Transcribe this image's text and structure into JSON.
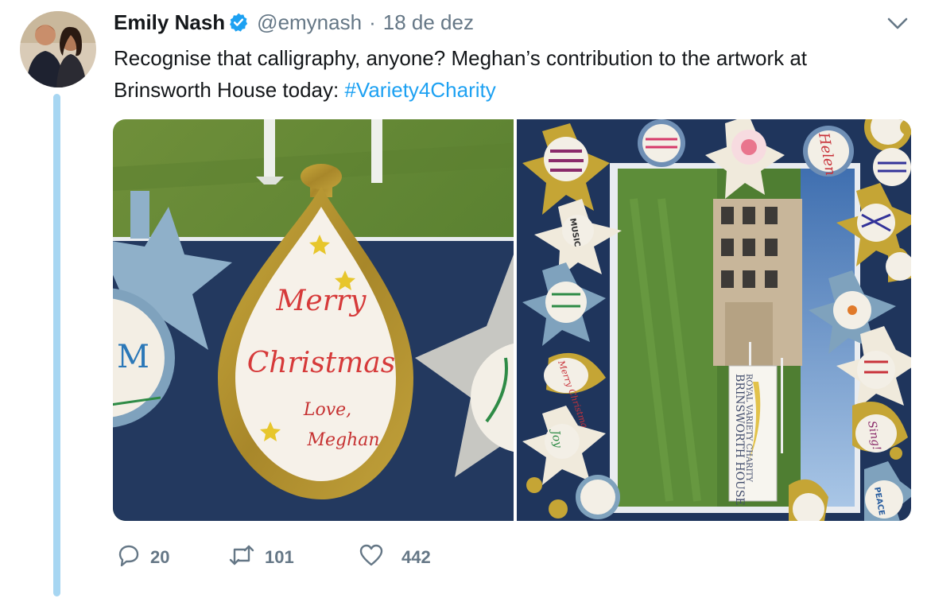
{
  "tweet": {
    "author_name": "Emily Nash",
    "handle": "@emynash",
    "separator": "·",
    "date": "18 de dez",
    "text_main": "Recognise that calligraphy, anyone? Meghan’s contribution to the artwork at Brinsworth House today: ",
    "hashtag": "#Variety4Charity"
  },
  "media": {
    "left_image": {
      "ornament_text_1": "Merry",
      "ornament_text_2": "Christmas",
      "ornament_text_3": "Love,",
      "ornament_text_4": "Meghan",
      "side_ornament_letter": "M"
    },
    "right_image": {
      "sign_line_1": "ROYAL VARIETY CHARITY",
      "sign_line_2": "BRINSWORTH HOUSE",
      "ornament_helen": "Helen",
      "ornament_music": "MUSIC",
      "ornament_joy": "Joy",
      "ornament_sing": "Sing!",
      "ornament_peace": "PEACE",
      "ornament_merry": "Merry Christmas"
    }
  },
  "actions": {
    "replies": "20",
    "retweets": "101",
    "likes": "442"
  },
  "colors": {
    "verified": "#1da1f2",
    "hashtag": "#1da1f2",
    "muted": "#657786",
    "thread_line": "#a7d6f2"
  }
}
